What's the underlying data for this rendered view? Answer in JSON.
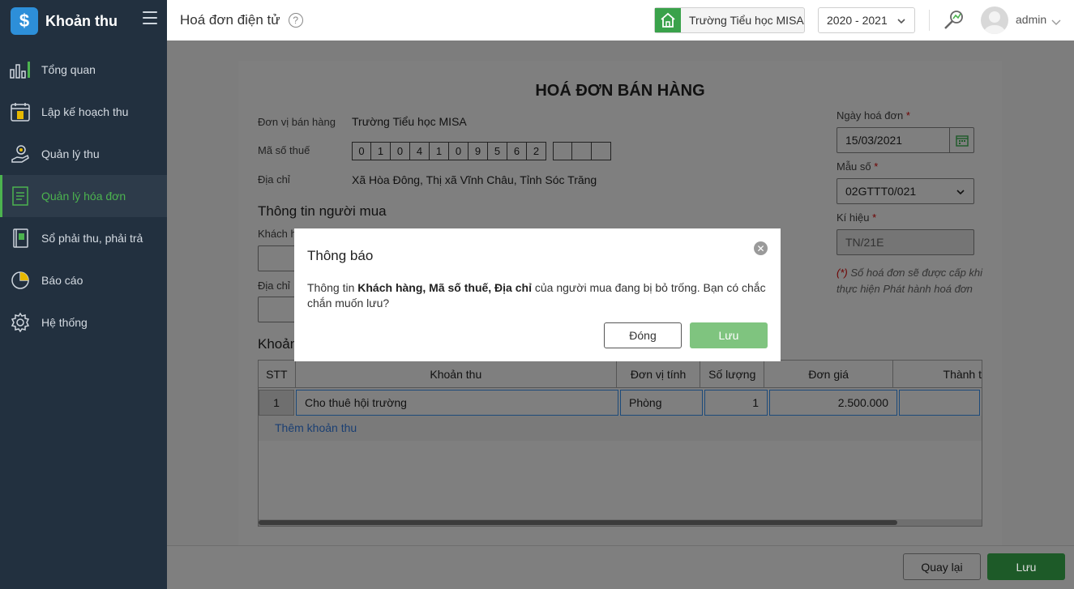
{
  "app": {
    "title": "Khoản thu",
    "brand_symbol": "$"
  },
  "sidebar": {
    "items": [
      {
        "label": "Tổng quan",
        "icon": "chart-bars-icon"
      },
      {
        "label": "Lập kế hoạch thu",
        "icon": "calendar-money-icon"
      },
      {
        "label": "Quản lý thu",
        "icon": "hand-coin-icon"
      },
      {
        "label": "Quản lý hóa đơn",
        "icon": "document-icon",
        "active": true
      },
      {
        "label": "Sổ phải thu, phải trả",
        "icon": "ledger-book-icon"
      },
      {
        "label": "Báo cáo",
        "icon": "pie-chart-icon"
      },
      {
        "label": "Hệ thống",
        "icon": "gear-icon"
      }
    ]
  },
  "header": {
    "page_title": "Hoá đơn điện tử",
    "help": "?",
    "school": "Trường Tiểu học MISA",
    "year": "2020 - 2021",
    "user": "admin"
  },
  "invoice": {
    "title": "HOÁ ĐƠN BÁN HÀNG",
    "seller_label": "Đơn vị bán hàng",
    "seller_value": "Trường Tiểu học MISA",
    "tax_label": "Mã số thuế",
    "tax_digits": [
      "0",
      "1",
      "0",
      "4",
      "1",
      "0",
      "9",
      "5",
      "6",
      "2"
    ],
    "tax_extra_digits": [
      "",
      "",
      ""
    ],
    "address_label": "Địa chỉ",
    "address_value": "Xã Hòa Đông, Thị xã Vĩnh Châu, Tỉnh Sóc Trăng",
    "buyer_section": "Thông tin người mua",
    "buyer_customer_label": "Khách h",
    "buyer_address_label": "Địa chỉ",
    "items_section": "Khoản",
    "date_label": "Ngày hoá đơn",
    "date_value": "15/03/2021",
    "template_label": "Mẫu số",
    "template_value": "02GTTT0/021",
    "symbol_label": "Kí hiệu",
    "symbol_value": "TN/21E",
    "required_mark": "*",
    "note_mark": "(*)",
    "note_text": " Số hoá đơn sẽ được cấp khi thực hiện Phát hành hoá đơn"
  },
  "table": {
    "headers": [
      "STT",
      "Khoản thu",
      "Đơn vị tính",
      "Số lượng",
      "Đơn giá",
      "Thành t"
    ],
    "rows": [
      {
        "stt": "1",
        "item": "Cho thuê hội trường",
        "unit": "Phòng",
        "qty": "1",
        "price": "2.500.000",
        "total": ""
      }
    ],
    "add_link": "Thêm khoản thu"
  },
  "footer": {
    "back": "Quay lại",
    "save": "Lưu"
  },
  "modal": {
    "title": "Thông báo",
    "body_prefix": "Thông tin ",
    "body_bold": "Khách hàng, Mã số thuế, Địa chỉ",
    "body_suffix": " của người mua đang bị bỏ trống. Bạn có chắc chắn muốn lưu?",
    "close_label": "Đóng",
    "ok_label": "Lưu"
  },
  "colors": {
    "accent": "#4cb34f",
    "sidebar": "#22303f",
    "brand": "#2d8fd9",
    "ok_button": "#7fc47f"
  }
}
